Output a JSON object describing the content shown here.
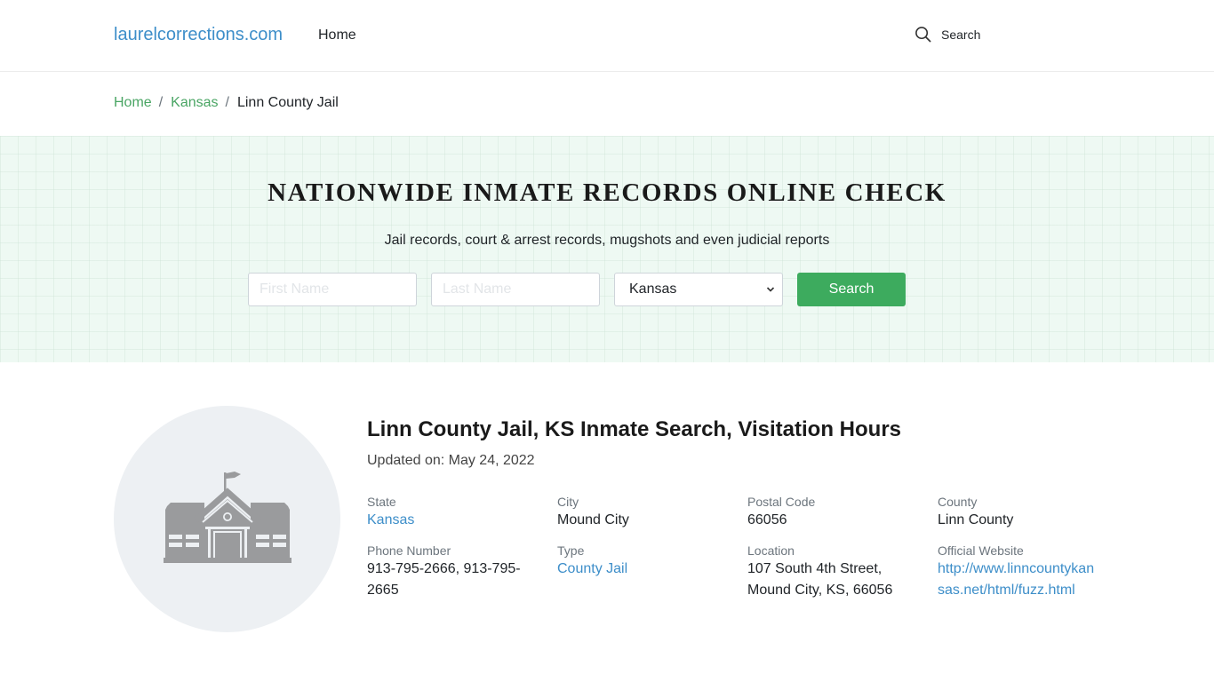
{
  "navbar": {
    "brand": "laurelcorrections.com",
    "home_link": "Home",
    "search_label": "Search",
    "search_icon": "search-icon"
  },
  "breadcrumb": [
    {
      "label": "Home"
    },
    {
      "label": "Kansas"
    },
    {
      "label": "Linn County Jail"
    }
  ],
  "breadcrumb_separator": "/",
  "hero": {
    "title": "NATIONWIDE INMATE RECORDS ONLINE CHECK",
    "subtitle": "Jail records, court & arrest records, mugshots and even judicial reports",
    "first_name_placeholder": "First Name",
    "first_name_value": "",
    "last_name_placeholder": "Last Name",
    "last_name_value": "",
    "state_selected": "Kansas",
    "search_button": "Search",
    "colors": {
      "button": "#3dab5e",
      "background": "#eef9f3"
    }
  },
  "facility": {
    "icon": "school-building-icon",
    "title": "Linn County Jail, KS Inmate Search, Visitation Hours",
    "updated": "Updated on: May 24, 2022",
    "fields": {
      "state": {
        "label": "State",
        "value": "Kansas"
      },
      "city": {
        "label": "City",
        "value": "Mound City"
      },
      "postal_code": {
        "label": "Postal Code",
        "value": "66056"
      },
      "county": {
        "label": "County",
        "value": "Linn County"
      },
      "phone": {
        "label": "Phone Number",
        "value": "913-795-2666, 913-795-2665"
      },
      "type": {
        "label": "Type",
        "value": "County Jail"
      },
      "location": {
        "label": "Location",
        "value": "107 South 4th Street, Mound City, KS, 66056"
      },
      "website": {
        "label": "Official Website",
        "value": "http://www.linncountykansas.net/html/fuzz.html"
      }
    }
  },
  "colors": {
    "link_blue": "#3d8ec9",
    "breadcrumb_green": "#4aa564"
  }
}
